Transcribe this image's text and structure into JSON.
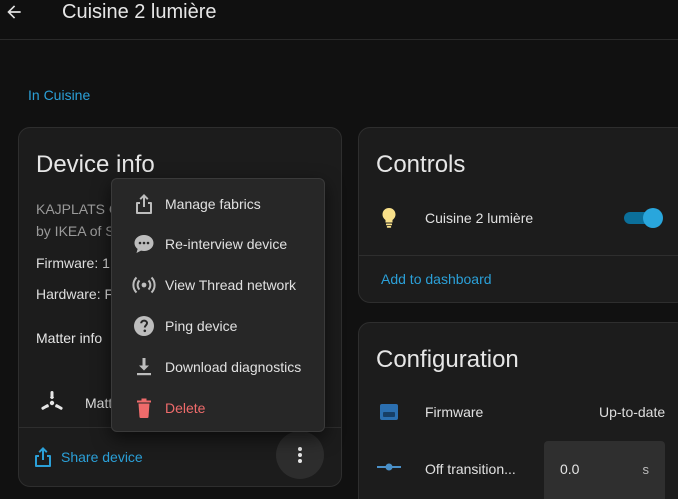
{
  "header": {
    "title": "Cuisine 2 lumière"
  },
  "area_link": "In Cuisine",
  "device_info": {
    "title": "Device info",
    "line1": "KAJPLATS C",
    "line2": "by IKEA of S",
    "firmware": "Firmware: 1",
    "hardware": "Hardware: F",
    "matter_info": "Matter info",
    "matter_label": "Matt",
    "share_label": "Share device"
  },
  "menu": {
    "items": [
      {
        "label": "Manage fabrics",
        "icon": "share-icon"
      },
      {
        "label": "Re-interview device",
        "icon": "chat-icon"
      },
      {
        "label": "View Thread network",
        "icon": "broadcast-icon"
      },
      {
        "label": "Ping device",
        "icon": "help-circle-icon"
      },
      {
        "label": "Download diagnostics",
        "icon": "download-icon"
      },
      {
        "label": "Delete",
        "icon": "trash-icon"
      }
    ]
  },
  "controls": {
    "title": "Controls",
    "entity_name": "Cuisine 2 lumière",
    "toggle_on": true,
    "add_dashboard": "Add to dashboard"
  },
  "configuration": {
    "title": "Configuration",
    "firmware_label": "Firmware",
    "firmware_value": "Up-to-date",
    "transition_label": "Off transition...",
    "transition_value": "0.0",
    "transition_unit": "s"
  },
  "colors": {
    "accent": "#2ba0d8",
    "danger": "#ef6b6b",
    "card_bg": "#1c1c1c",
    "page_bg": "#111111",
    "bulb": "#f8e08a"
  }
}
